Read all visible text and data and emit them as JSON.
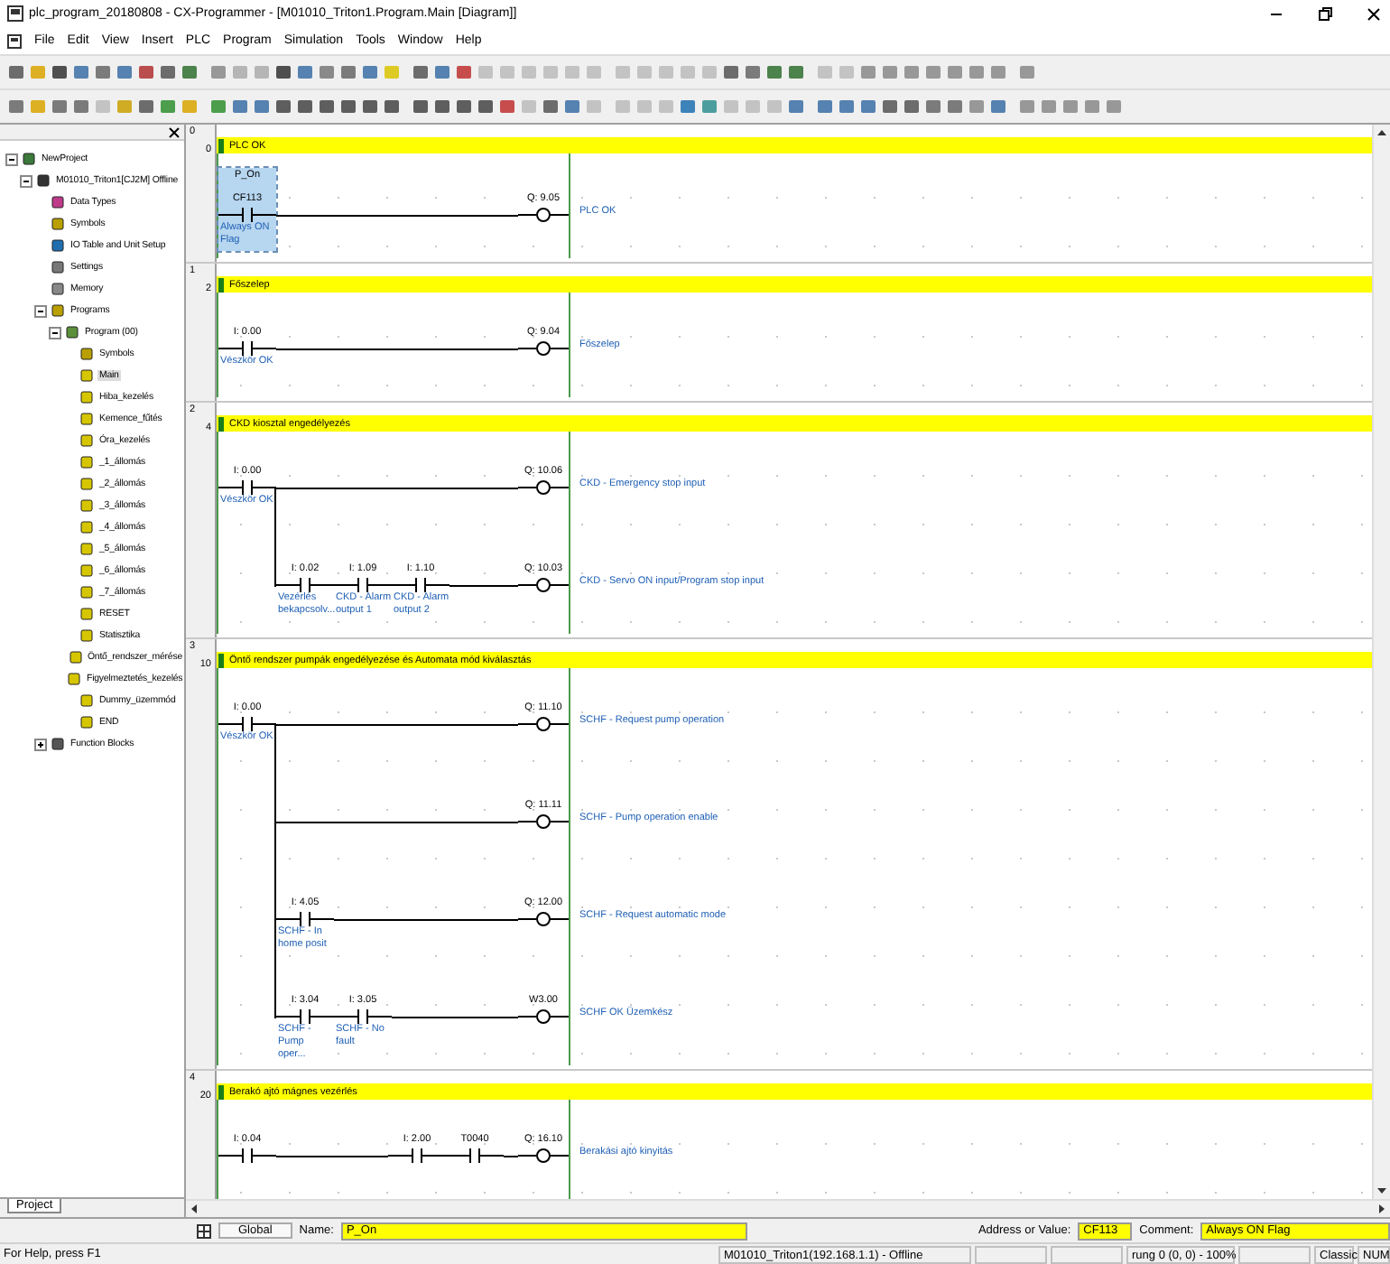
{
  "window": {
    "title": "plc_program_20180808 - CX-Programmer - [M01010_Triton1.Program.Main [Diagram]]"
  },
  "menu": [
    "File",
    "Edit",
    "View",
    "Insert",
    "PLC",
    "Program",
    "Simulation",
    "Tools",
    "Window",
    "Help"
  ],
  "tree": [
    {
      "label": "NewProject",
      "kind": "project",
      "expanded": true,
      "selected": false,
      "children": [
        {
          "label": "M01010_Triton1[CJ2M] Offline",
          "kind": "plc",
          "expanded": true,
          "selected": false,
          "children": [
            {
              "label": "Data Types",
              "kind": "types",
              "selected": false
            },
            {
              "label": "Symbols",
              "kind": "symbols",
              "selected": false
            },
            {
              "label": "IO Table and Unit Setup",
              "kind": "io",
              "selected": false
            },
            {
              "label": "Settings",
              "kind": "settings",
              "selected": false
            },
            {
              "label": "Memory",
              "kind": "memory",
              "selected": false
            },
            {
              "label": "Programs",
              "kind": "programs",
              "expanded": true,
              "selected": false,
              "children": [
                {
                  "label": "Program (00)",
                  "kind": "program",
                  "expanded": true,
                  "selected": false,
                  "children": [
                    {
                      "label": "Symbols",
                      "kind": "symbols",
                      "selected": false
                    },
                    {
                      "label": "Main",
                      "kind": "section",
                      "selected": true
                    },
                    {
                      "label": "Hiba_kezelés",
                      "kind": "section",
                      "selected": false
                    },
                    {
                      "label": "Kemence_fűtés",
                      "kind": "section",
                      "selected": false
                    },
                    {
                      "label": "Óra_kezelés",
                      "kind": "section",
                      "selected": false
                    },
                    {
                      "label": "_1_állomás",
                      "kind": "section",
                      "selected": false
                    },
                    {
                      "label": "_2_állomás",
                      "kind": "section",
                      "selected": false
                    },
                    {
                      "label": "_3_állomás",
                      "kind": "section",
                      "selected": false
                    },
                    {
                      "label": "_4_állomás",
                      "kind": "section",
                      "selected": false
                    },
                    {
                      "label": "_5_állomás",
                      "kind": "section",
                      "selected": false
                    },
                    {
                      "label": "_6_állomás",
                      "kind": "section",
                      "selected": false
                    },
                    {
                      "label": "_7_állomás",
                      "kind": "section",
                      "selected": false
                    },
                    {
                      "label": "RESET",
                      "kind": "section",
                      "selected": false
                    },
                    {
                      "label": "Statisztika",
                      "kind": "section",
                      "selected": false
                    },
                    {
                      "label": "Öntő_rendszer_mérése",
                      "kind": "section",
                      "selected": false
                    },
                    {
                      "label": "Figyelmeztetés_kezelés",
                      "kind": "section",
                      "selected": false
                    },
                    {
                      "label": "Dummy_üzemmód",
                      "kind": "section",
                      "selected": false
                    },
                    {
                      "label": "END",
                      "kind": "section",
                      "selected": false
                    }
                  ]
                }
              ]
            },
            {
              "label": "Function Blocks",
              "kind": "blocks",
              "expanded": false,
              "selected": false
            }
          ]
        }
      ]
    }
  ],
  "panel_tab": "Project",
  "rungs": [
    {
      "index": "0",
      "step": "0",
      "comment": "PLC OK",
      "lines": [
        {
          "branch": false,
          "contacts": [
            {
              "name": "P_On",
              "address": "CF113",
              "comment": "Always ON Flag",
              "selected": true
            }
          ],
          "coil": {
            "address": "Q: 9.05",
            "comment": "PLC OK"
          }
        }
      ]
    },
    {
      "index": "1",
      "step": "2",
      "comment": "Főszelep",
      "lines": [
        {
          "branch": false,
          "contacts": [
            {
              "address": "I: 0.00",
              "comment": "Vészkör OK",
              "selected": false
            }
          ],
          "coil": {
            "address": "Q: 9.04",
            "comment": "Főszelep"
          }
        }
      ]
    },
    {
      "index": "2",
      "step": "4",
      "comment": "CKD kiosztal engedélyezés",
      "lines": [
        {
          "branch": false,
          "contacts": [
            {
              "address": "I: 0.00",
              "comment": "Vészkör OK",
              "selected": false
            }
          ],
          "coil": {
            "address": "Q: 10.06",
            "comment": "CKD - Emergency stop input"
          }
        },
        {
          "branch": true,
          "contacts": [
            {
              "address": "I: 0.02",
              "comment": "Vezérlés bekapcsolv...",
              "selected": false
            },
            {
              "address": "I: 1.09",
              "comment": "CKD - Alarm output 1",
              "selected": false
            },
            {
              "address": "I: 1.10",
              "comment": "CKD - Alarm output 2",
              "selected": false
            }
          ],
          "coil": {
            "address": "Q: 10.03",
            "comment": "CKD - Servo ON input/Program stop input"
          }
        }
      ]
    },
    {
      "index": "3",
      "step": "10",
      "comment": "Öntő rendszer pumpák engedélyezése és Automata mód kiválasztás",
      "lines": [
        {
          "branch": false,
          "contacts": [
            {
              "address": "I: 0.00",
              "comment": "Vészkör OK",
              "selected": false
            }
          ],
          "coil": {
            "address": "Q: 11.10",
            "comment": "SCHF - Request pump operation"
          }
        },
        {
          "branch": true,
          "coil": {
            "address": "Q: 11.11",
            "comment": "SCHF - Pump operation enable"
          }
        },
        {
          "branch": true,
          "contacts": [
            {
              "address": "I: 4.05",
              "comment": "SCHF - In home posit",
              "selected": false
            }
          ],
          "coil": {
            "address": "Q: 12.00",
            "comment": "SCHF - Request automatic mode"
          }
        },
        {
          "branch": true,
          "contacts": [
            {
              "address": "I: 3.04",
              "comment": "SCHF - Pump oper...",
              "selected": false
            },
            {
              "address": "I: 3.05",
              "comment": "SCHF - No fault",
              "selected": false
            }
          ],
          "coil": {
            "address": "W3.00",
            "comment": "SCHF OK Üzemkész"
          }
        }
      ]
    },
    {
      "index": "4",
      "step": "20",
      "comment": "Berakó ajtó mágnes vezérlés",
      "lines": [
        {
          "branch": false,
          "contacts": [
            {
              "address": "I: 0.04",
              "selected": false
            }
          ],
          "contacts_near_coil": [
            {
              "address": "I: 2.00",
              "selected": false
            },
            {
              "address": "T0040",
              "selected": false
            }
          ],
          "coil": {
            "address": "Q: 16.10",
            "comment": "Berakási ajtó kinyitás"
          }
        }
      ]
    }
  ],
  "symbol_bar": {
    "scope": "Global",
    "name_label": "Name:",
    "name": "P_On",
    "address_label": "Address or Value:",
    "address": "CF113",
    "comment_label": "Comment:",
    "comment": "Always ON Flag"
  },
  "status_bar": {
    "help": "For Help, press F1",
    "connection": "M01010_Triton1(192.168.1.1) - Offline",
    "position": "rung 0 (0, 0) - 100%",
    "mode": "Classic",
    "num": "NUM"
  }
}
